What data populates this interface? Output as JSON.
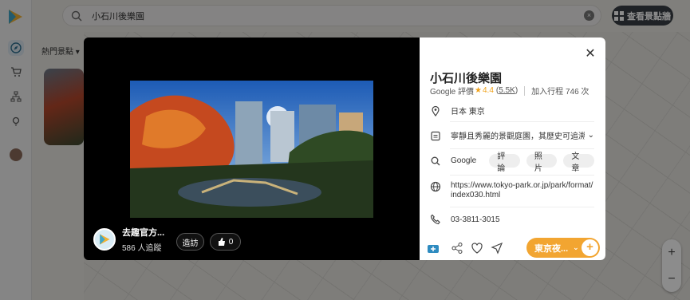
{
  "search": {
    "value": "小石川後樂園"
  },
  "topbar": {
    "look_places_label": "查看景點牆"
  },
  "filter": {
    "label": "熱門景點"
  },
  "author": {
    "name": "去趣官方...",
    "followers": "586 人追蹤",
    "visit_label": "造訪",
    "like_count": "0"
  },
  "place": {
    "name": "小石川後樂園",
    "rating_source": "Google 評價",
    "rating": "4.4",
    "review_count": "5.5K",
    "added_count": "加入行程 746 次",
    "location": "日本 東京",
    "description": "寧靜且秀麗的景觀庭園，其歷史可追溯...",
    "google_label": "Google",
    "google_tags": [
      "評論",
      "照片",
      "文章"
    ],
    "url": "https://www.tokyo-park.or.jp/park/format/index030.html",
    "phone": "03-3811-3015"
  },
  "trip_button": {
    "label": "東京夜..."
  },
  "colors": {
    "accent_orange": "#f2a531",
    "star": "#f0a21b",
    "dark_button": "#3a3f45"
  },
  "icons": [
    "logo-icon",
    "compass-icon",
    "cart-icon",
    "sitemap-icon",
    "bulb-icon",
    "search-icon",
    "clear-icon",
    "grid-icon",
    "close-icon",
    "pin-icon",
    "calendar-icon",
    "search-small-icon",
    "globe-icon",
    "phone-icon",
    "add-photo-icon",
    "share-icon",
    "heart-icon",
    "send-icon",
    "thumb-up-icon"
  ]
}
